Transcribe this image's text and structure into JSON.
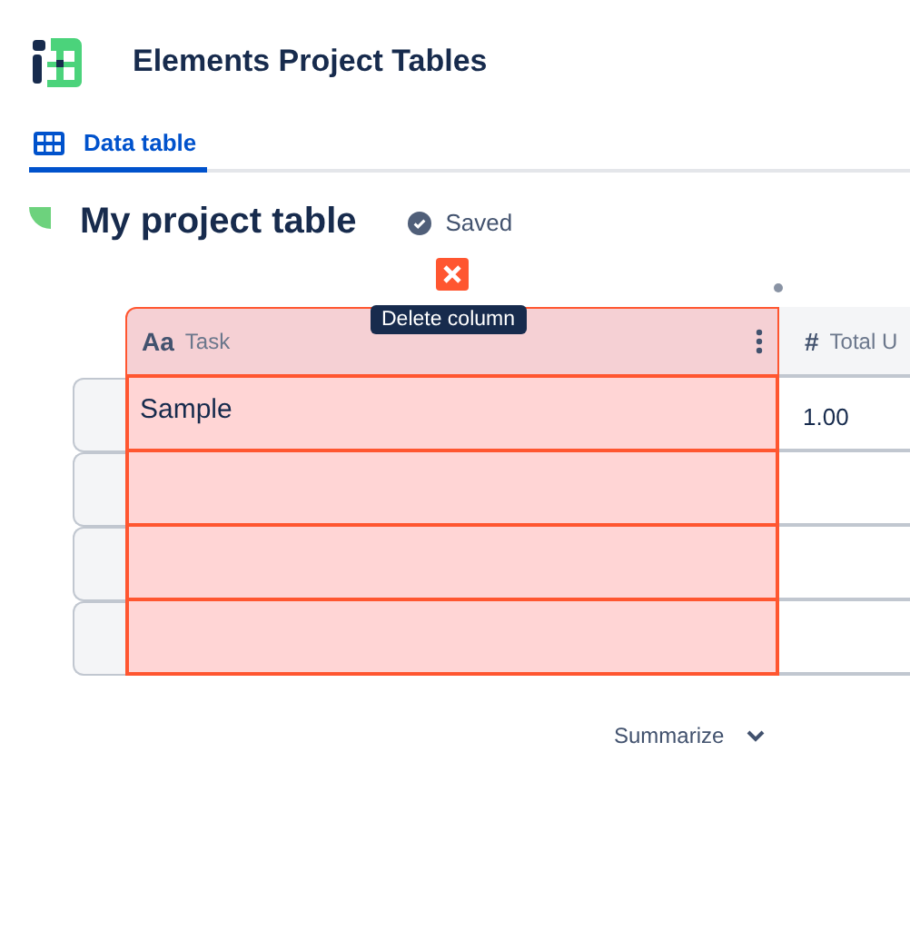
{
  "app": {
    "title": "Elements Project Tables"
  },
  "tabs": [
    {
      "label": "Data table",
      "selected": true
    }
  ],
  "table_title": "My project table",
  "save_status": "Saved",
  "delete_tooltip": "Delete column",
  "columns": [
    {
      "type_icon": "Aa",
      "label": "Task",
      "selected": true
    },
    {
      "type_icon": "#",
      "label": "Total U",
      "selected": false
    }
  ],
  "rows": [
    {
      "task": "Sample",
      "column_2": "1.00"
    },
    {},
    {},
    {}
  ],
  "summarize": {
    "label": "Summarize"
  }
}
